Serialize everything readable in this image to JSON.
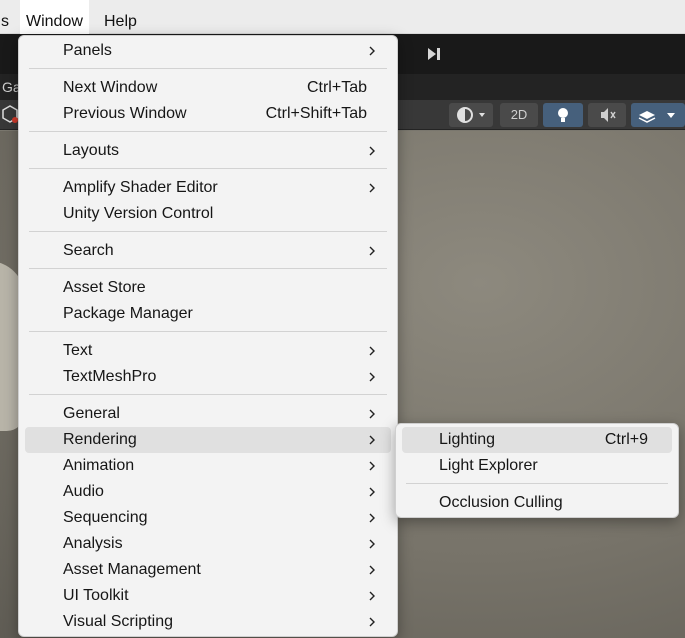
{
  "menubar": {
    "items": [
      {
        "label": "s"
      },
      {
        "label": "Window"
      },
      {
        "label": "Help"
      }
    ]
  },
  "toolbar": {
    "step_icon": "step-forward-icon",
    "step_glyph": "▶|"
  },
  "tab": {
    "label": "Ga"
  },
  "scene_toolbar": {
    "btn_2d": "2D"
  },
  "window_menu": {
    "items": [
      {
        "label": "Panels",
        "submenu": true
      },
      {
        "label": "Next Window",
        "shortcut": "Ctrl+Tab"
      },
      {
        "label": "Previous Window",
        "shortcut": "Ctrl+Shift+Tab"
      },
      {
        "label": "Layouts",
        "submenu": true
      },
      {
        "label": "Amplify Shader Editor",
        "submenu": true
      },
      {
        "label": "Unity Version Control"
      },
      {
        "label": "Search",
        "submenu": true
      },
      {
        "label": "Asset Store"
      },
      {
        "label": "Package Manager"
      },
      {
        "label": "Text",
        "submenu": true
      },
      {
        "label": "TextMeshPro",
        "submenu": true
      },
      {
        "label": "General",
        "submenu": true
      },
      {
        "label": "Rendering",
        "submenu": true,
        "highlighted": true
      },
      {
        "label": "Animation",
        "submenu": true
      },
      {
        "label": "Audio",
        "submenu": true
      },
      {
        "label": "Sequencing",
        "submenu": true
      },
      {
        "label": "Analysis",
        "submenu": true
      },
      {
        "label": "Asset Management",
        "submenu": true
      },
      {
        "label": "UI Toolkit",
        "submenu": true
      },
      {
        "label": "Visual Scripting",
        "submenu": true
      }
    ]
  },
  "rendering_submenu": {
    "items": [
      {
        "label": "Lighting",
        "shortcut": "Ctrl+9",
        "highlighted": true
      },
      {
        "label": "Light Explorer"
      },
      {
        "label": "Occlusion Culling"
      }
    ]
  },
  "colors": {
    "menu_bg": "#f3f3f3",
    "highlight": "#e0e0e0",
    "accent_blue": "#46607c"
  }
}
